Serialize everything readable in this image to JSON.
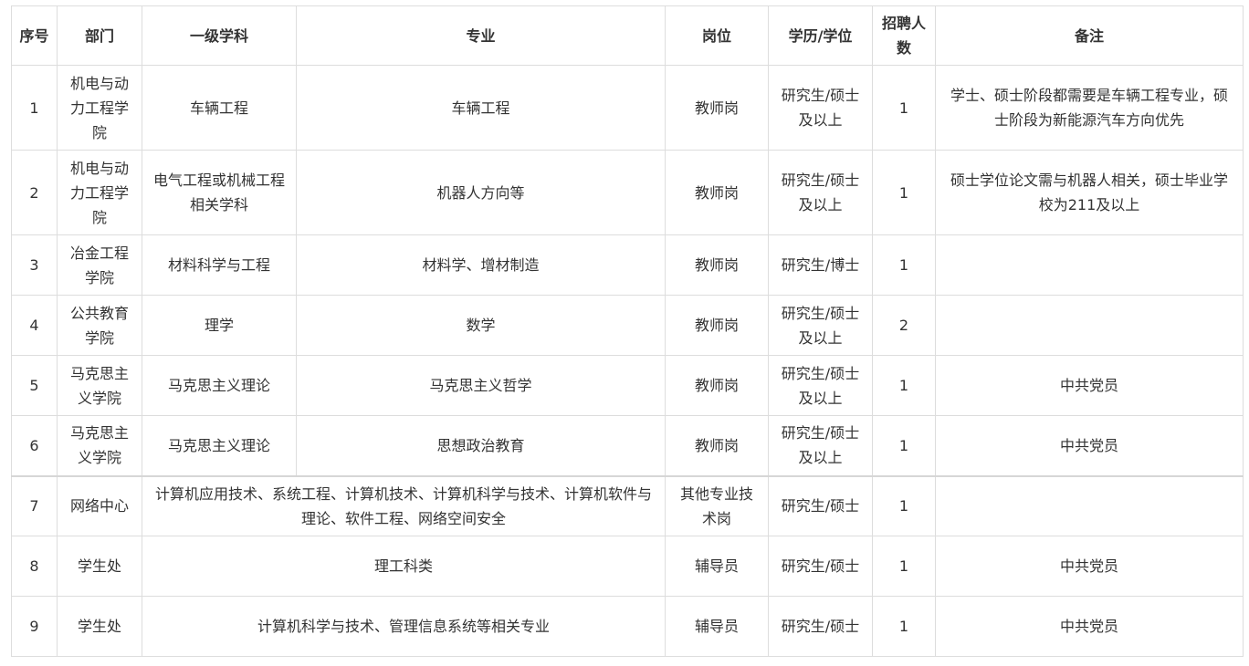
{
  "table": {
    "headers": [
      "序号",
      "部门",
      "一级学科",
      "专业",
      "岗位",
      "学历/学位",
      "招聘人数",
      "备注"
    ],
    "rows": [
      {
        "no": "1",
        "dept": "机电与动力工程学院",
        "discipline": "车辆工程",
        "major": "车辆工程",
        "post": "教师岗",
        "degree": "研究生/硕士及以上",
        "count": "1",
        "note": "学士、硕士阶段都需要是车辆工程专业，硕士阶段为新能源汽车方向优先"
      },
      {
        "no": "2",
        "dept": "机电与动力工程学院",
        "discipline": "电气工程或机械工程相关学科",
        "major": "机器人方向等",
        "post": "教师岗",
        "degree": "研究生/硕士及以上",
        "count": "1",
        "note": "硕士学位论文需与机器人相关，硕士毕业学校为211及以上"
      },
      {
        "no": "3",
        "dept": "冶金工程学院",
        "discipline": "材料科学与工程",
        "major": "材料学、增材制造",
        "post": "教师岗",
        "degree": "研究生/博士",
        "count": "1",
        "note": ""
      },
      {
        "no": "4",
        "dept": "公共教育学院",
        "discipline": "理学",
        "major": "数学",
        "post": "教师岗",
        "degree": "研究生/硕士及以上",
        "count": "2",
        "note": ""
      },
      {
        "no": "5",
        "dept": "马克思主义学院",
        "discipline": "马克思主义理论",
        "major": "马克思主义哲学",
        "post": "教师岗",
        "degree": "研究生/硕士及以上",
        "count": "1",
        "note": "中共党员"
      },
      {
        "no": "6",
        "dept": "马克思主义学院",
        "discipline": "马克思主义理论",
        "major": "思想政治教育",
        "post": "教师岗",
        "degree": "研究生/硕士及以上",
        "count": "1",
        "note": "中共党员"
      },
      {
        "no": "7",
        "dept": "网络中心",
        "merged_major": "计算机应用技术、系统工程、计算机技术、计算机科学与技术、计算机软件与理论、软件工程、网络空间安全",
        "post": "其他专业技术岗",
        "degree": "研究生/硕士",
        "count": "1",
        "note": ""
      },
      {
        "no": "8",
        "dept": "学生处",
        "merged_major": "理工科类",
        "post": "辅导员",
        "degree": "研究生/硕士",
        "count": "1",
        "note": "中共党员"
      },
      {
        "no": "9",
        "dept": "学生处",
        "merged_major": "计算机科学与技术、管理信息系统等相关专业",
        "post": "辅导员",
        "degree": "研究生/硕士",
        "count": "1",
        "note": "中共党员"
      }
    ]
  }
}
